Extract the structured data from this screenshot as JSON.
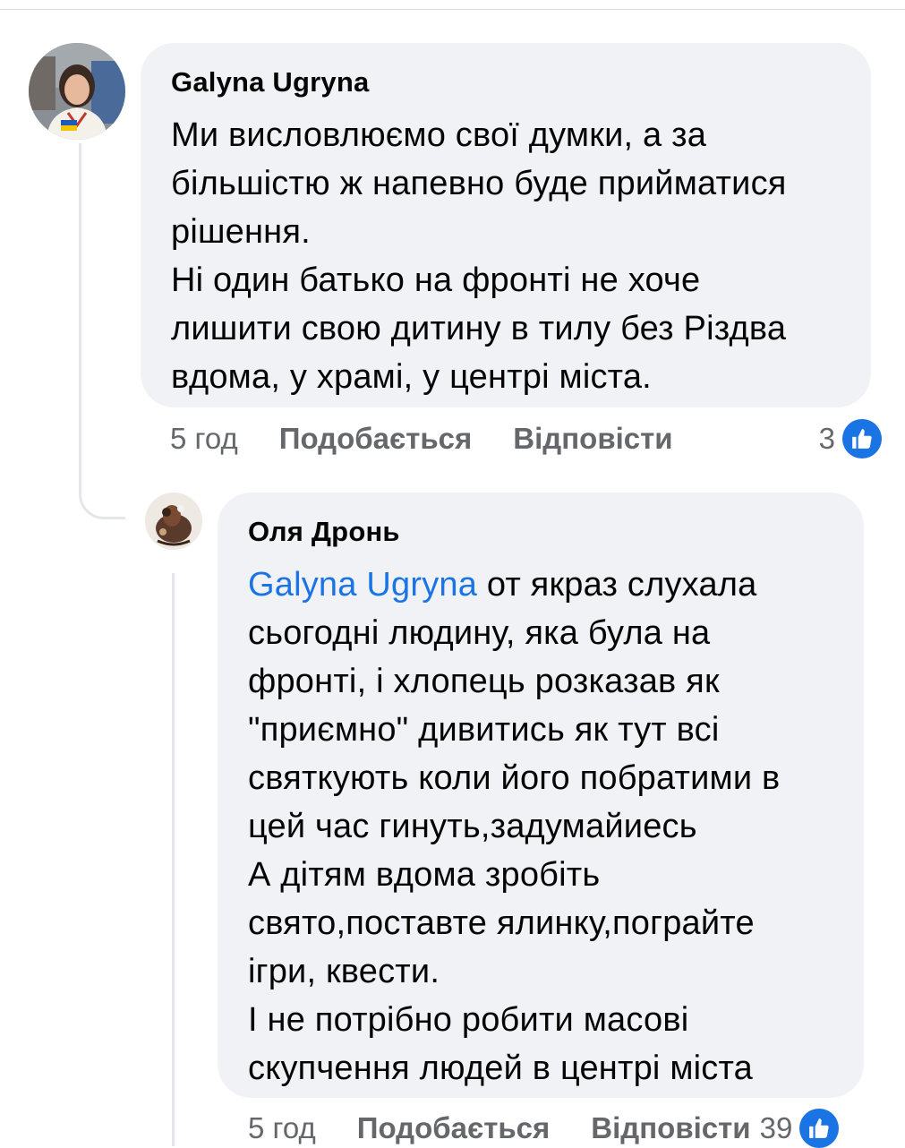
{
  "comments": [
    {
      "author": "Galyna Ugryna",
      "text": "Ми висловлюємо свої думки, а за\nбільшістю ж напевно буде прийматися\nрішення.\nНі один батько на фронті не хоче\nлишити свою дитину в тилу без Різдва\nвдома, у храмі, у центрі міста.",
      "time": "5 год",
      "like_label": "Подобається",
      "reply_label": "Відповісти",
      "reactions": "3"
    },
    {
      "author": "Оля Дронь",
      "mention": "Galyna Ugryna",
      "text": " от якраз слухала\nсьогодні людину, яка була на\nфронті, і хлопець розказав як\n\"приємно\" дивитись як тут всі\nсвяткують коли його побратими в\nцей час гинуть,задумайиесь\nА дітям вдома зробіть\nсвято,поставте ялинку,пограйте\nігри, квести.\nІ не потрібно робити масові\nскупчення людей в центрі міста",
      "time": "5 год",
      "like_label": "Подобається",
      "reply_label": "Відповісти",
      "reactions": "39"
    }
  ],
  "colors": {
    "bubble": "#f0f2f5",
    "link": "#1b74e4",
    "meta": "#65676b",
    "reaction_badge": "#1b74e4"
  },
  "icons": {
    "reaction": "thumbs-up-icon"
  }
}
